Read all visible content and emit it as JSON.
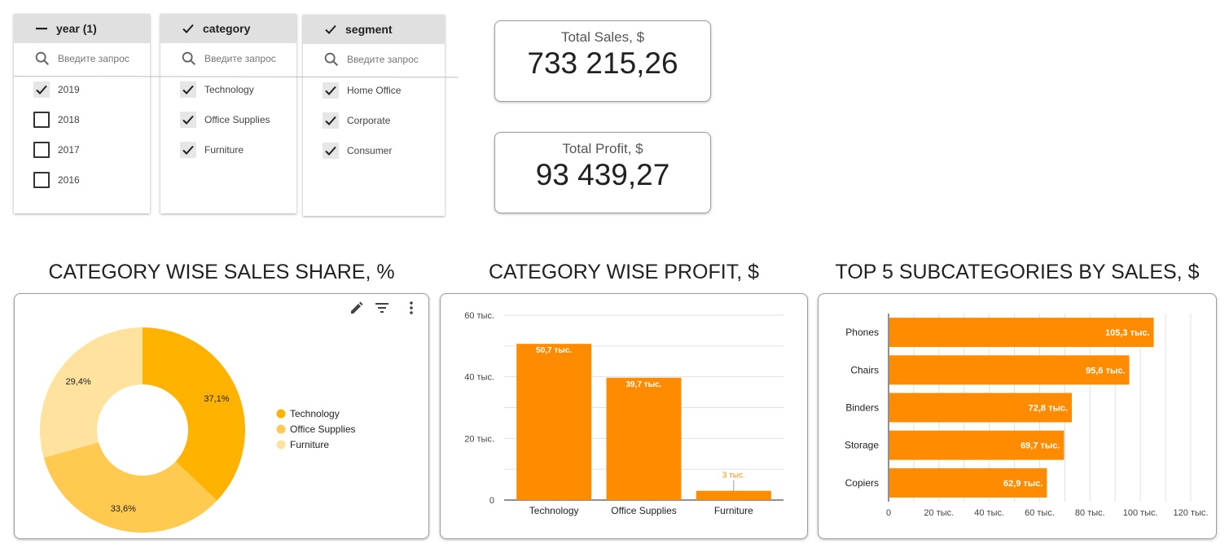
{
  "filters": {
    "year": {
      "header": "year (1)",
      "search_placeholder": "Введите запрос",
      "items": [
        {
          "label": "2019",
          "checked": true
        },
        {
          "label": "2018",
          "checked": false
        },
        {
          "label": "2017",
          "checked": false
        },
        {
          "label": "2016",
          "checked": false
        }
      ]
    },
    "category": {
      "header": "category",
      "search_placeholder": "Введите запрос",
      "items": [
        {
          "label": "Technology",
          "checked": true
        },
        {
          "label": "Office Supplies",
          "checked": true
        },
        {
          "label": "Furniture",
          "checked": true
        }
      ]
    },
    "segment": {
      "header": "segment",
      "search_placeholder": "Введите запрос",
      "items": [
        {
          "label": "Home Office",
          "checked": true
        },
        {
          "label": "Corporate",
          "checked": true
        },
        {
          "label": "Consumer",
          "checked": true
        }
      ]
    }
  },
  "kpis": {
    "sales": {
      "label": "Total Sales, $",
      "value": "733 215,26"
    },
    "profit": {
      "label": "Total Profit, $",
      "value": "93 439,27"
    }
  },
  "titles": {
    "donut": "CATEGORY WISE SALES SHARE, %",
    "profit": "CATEGORY WISE PROFIT, $",
    "top5": "TOP 5 SUBCATEGORIES BY SALES, $"
  },
  "icons": {
    "edit": "pencil-icon",
    "filter": "filter-icon",
    "menu": "more-vert-icon",
    "search": "search-icon"
  },
  "colors": {
    "accent": "#ff8c00",
    "donut": [
      "#ffb300",
      "#ffca4f",
      "#ffe29e"
    ]
  },
  "chart_data": [
    {
      "type": "pie",
      "title": "CATEGORY WISE SALES SHARE, %",
      "donut": true,
      "categories": [
        "Technology",
        "Office Supplies",
        "Furniture"
      ],
      "values": [
        37.1,
        33.6,
        29.4
      ],
      "labels": [
        "37,1%",
        "33,6%",
        "29,4%"
      ],
      "legend": "right"
    },
    {
      "type": "bar",
      "title": "CATEGORY WISE PROFIT, $",
      "categories": [
        "Technology",
        "Office Supplies",
        "Furniture"
      ],
      "values": [
        50700,
        39700,
        3000
      ],
      "labels": [
        "50,7 тыс.",
        "39,7 тыс.",
        "3 тыс."
      ],
      "ylim": [
        0,
        60000
      ],
      "yticks": [
        0,
        20000,
        40000,
        60000
      ],
      "ytick_labels": [
        "0",
        "20 тыс.",
        "40 тыс.",
        "60 тыс."
      ],
      "grid": true
    },
    {
      "type": "bar",
      "orientation": "horizontal",
      "title": "TOP 5 SUBCATEGORIES BY SALES, $",
      "categories": [
        "Phones",
        "Chairs",
        "Binders",
        "Storage",
        "Copiers"
      ],
      "values": [
        105300,
        95600,
        72800,
        69700,
        62900
      ],
      "labels": [
        "105,3 тыс.",
        "95,6 тыс.",
        "72,8 тыс.",
        "69,7 тыс.",
        "62,9 тыс."
      ],
      "xlim": [
        0,
        120000
      ],
      "xticks": [
        0,
        20000,
        40000,
        60000,
        80000,
        100000,
        120000
      ],
      "xtick_labels": [
        "0",
        "20 тыс.",
        "40 тыс.",
        "60 тыс.",
        "80 тыс.",
        "100 тыс.",
        "120 тыс."
      ],
      "grid": true
    }
  ]
}
